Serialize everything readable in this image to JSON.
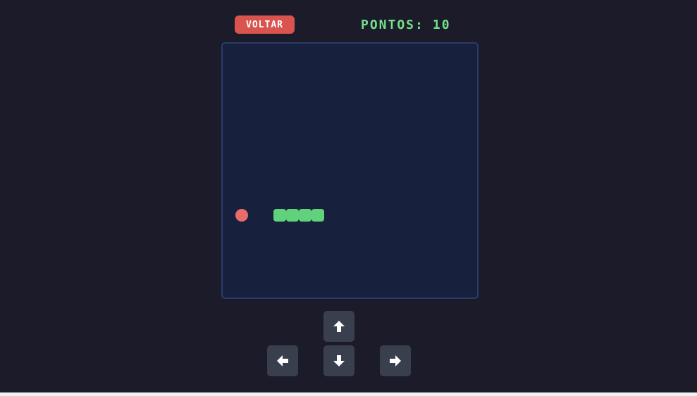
{
  "header": {
    "back_label": "VOLTAR",
    "score_label": "PONTOS:",
    "score_value": "10"
  },
  "game": {
    "grid_cells": 20,
    "food": {
      "col": 1,
      "row": 13
    },
    "snake": [
      {
        "col": 4,
        "row": 13
      },
      {
        "col": 5,
        "row": 13
      },
      {
        "col": 6,
        "row": 13
      },
      {
        "col": 7,
        "row": 13
      }
    ]
  },
  "controls": [
    {
      "direction": "up",
      "icon": "arrow-up-icon"
    },
    {
      "direction": "left",
      "icon": "arrow-left-icon"
    },
    {
      "direction": "down",
      "icon": "arrow-down-icon"
    },
    {
      "direction": "right",
      "icon": "arrow-right-icon"
    }
  ],
  "colors": {
    "background": "#1b1b2a",
    "board": "#17213d",
    "board_border": "#2a3c6b",
    "snake": "#5fd27b",
    "food": "#ea6b6b",
    "score": "#74e08a",
    "back_button": "#d9534f",
    "control_button": "#3a3f4d"
  }
}
